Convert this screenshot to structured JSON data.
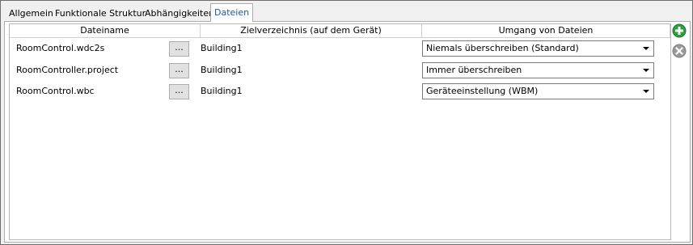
{
  "tabs": [
    {
      "label": "Allgemein",
      "active": false
    },
    {
      "label": "Funktionale Struktur",
      "active": false
    },
    {
      "label": "Abhängigkeiten",
      "active": false
    },
    {
      "label": "Dateien",
      "active": true
    }
  ],
  "table": {
    "headers": [
      "Dateiname",
      "Zielverzeichnis (auf dem Gerät)",
      "Umgang von Dateien"
    ],
    "browse_label": "...",
    "rows": [
      {
        "name": "RoomControl.wdc2s",
        "dir": "Building1",
        "mode": "Niemals überschreiben (Standard)"
      },
      {
        "name": "RoomController.project",
        "dir": "Building1",
        "mode": "Immer überschreiben"
      },
      {
        "name": "RoomControl.wbc",
        "dir": "Building1",
        "mode": "Geräteeinstellung (WBM)"
      }
    ]
  },
  "colors": {
    "accent_tab": "#1e5aa0",
    "add": "#2e9e3e",
    "remove": "#9a9a9a"
  },
  "icons": {
    "add": "add-icon",
    "remove": "remove-icon"
  }
}
